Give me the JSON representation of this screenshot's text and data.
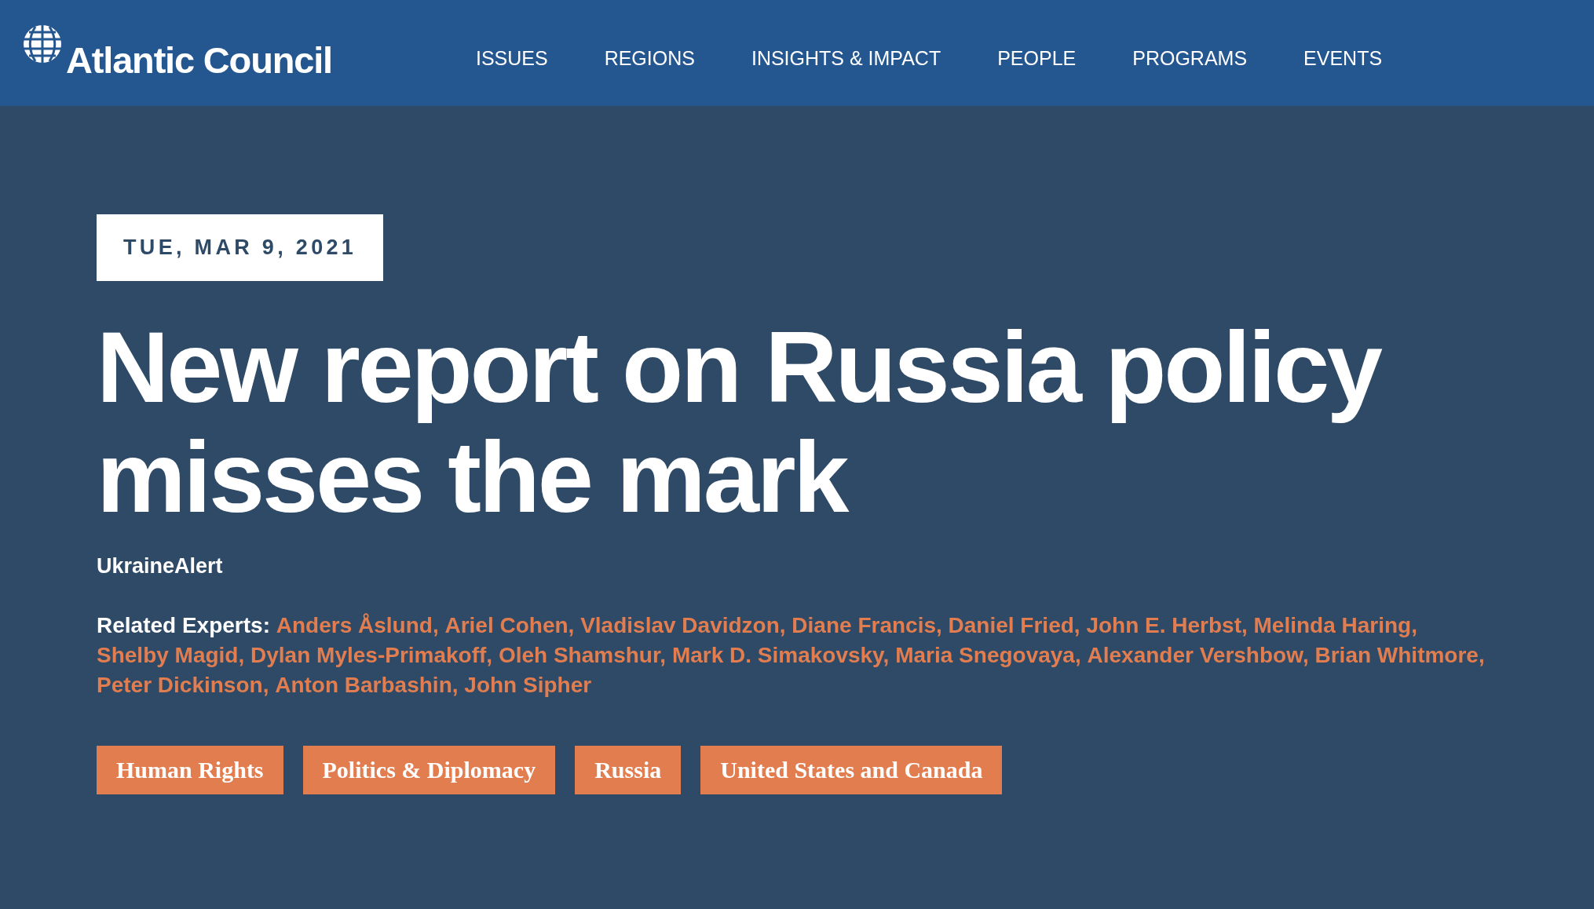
{
  "header": {
    "logo": "Atlantic Council",
    "nav": [
      "ISSUES",
      "REGIONS",
      "INSIGHTS & IMPACT",
      "PEOPLE",
      "PROGRAMS",
      "EVENTS"
    ]
  },
  "article": {
    "date": "TUE, MAR 9, 2021",
    "title": "New report on Russia policy misses the mark",
    "series": "UkraineAlert",
    "experts_label": "Related Experts:",
    "experts": [
      "Anders Åslund,",
      "Ariel Cohen,",
      "Vladislav Davidzon,",
      "Diane Francis,",
      "Daniel Fried,",
      "John E. Herbst,",
      "Melinda Haring,",
      "Shelby Magid,",
      "Dylan Myles-Primakoff,",
      "Oleh Shamshur,",
      "Mark D. Simakovsky,",
      "Maria Snegovaya,",
      "Alexander Vershbow,",
      "Brian Whitmore,",
      "Peter Dickinson,",
      "Anton Barbashin,",
      "John Sipher"
    ],
    "tags": [
      "Human Rights",
      "Politics & Diplomacy",
      "Russia",
      "United States and Canada"
    ]
  }
}
